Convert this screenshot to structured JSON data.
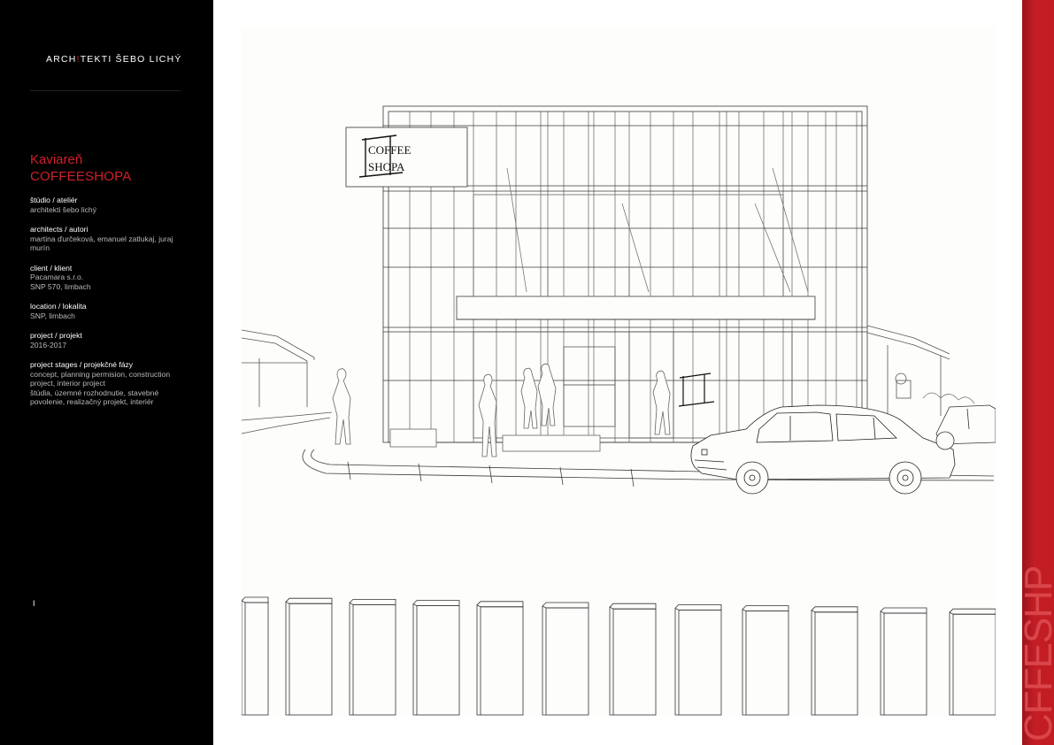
{
  "header": {
    "logo_part1": "ARCH",
    "logo_mark": "!",
    "logo_part2": "TEKTI ŠEBO LICHÝ"
  },
  "project": {
    "title_line1": "Kaviareň",
    "title_line2": "COFFEESHOPA"
  },
  "info": [
    {
      "label": "štúdio / ateliér",
      "value": "architekti šebo lichý"
    },
    {
      "label": "architects / autori",
      "value": "martina ďurčeková, emanuel zatlukaj, juraj murín"
    },
    {
      "label": "client / klient",
      "value": "Pacamara s.r.o.\nSNP 570, limbach"
    },
    {
      "label": "location / lokalita",
      "value": "SNP, limbach"
    },
    {
      "label": "project / projekt",
      "value": "2016-2017"
    },
    {
      "label": "project stages / projekčné fázy",
      "value": "concept, planning permision, construction project, interior project\nštúdia, územné rozhodnutie, stavebné povolenie, realizačný projekt, interiér"
    }
  ],
  "page_number": "I",
  "side_label": "CFFESHP",
  "sign": {
    "line1": "COFFEE",
    "line2": "SHOPA"
  },
  "colors": {
    "accent_red": "#d0202a",
    "sidebar_bg": "#000000",
    "strip_red": "#c41e25"
  }
}
